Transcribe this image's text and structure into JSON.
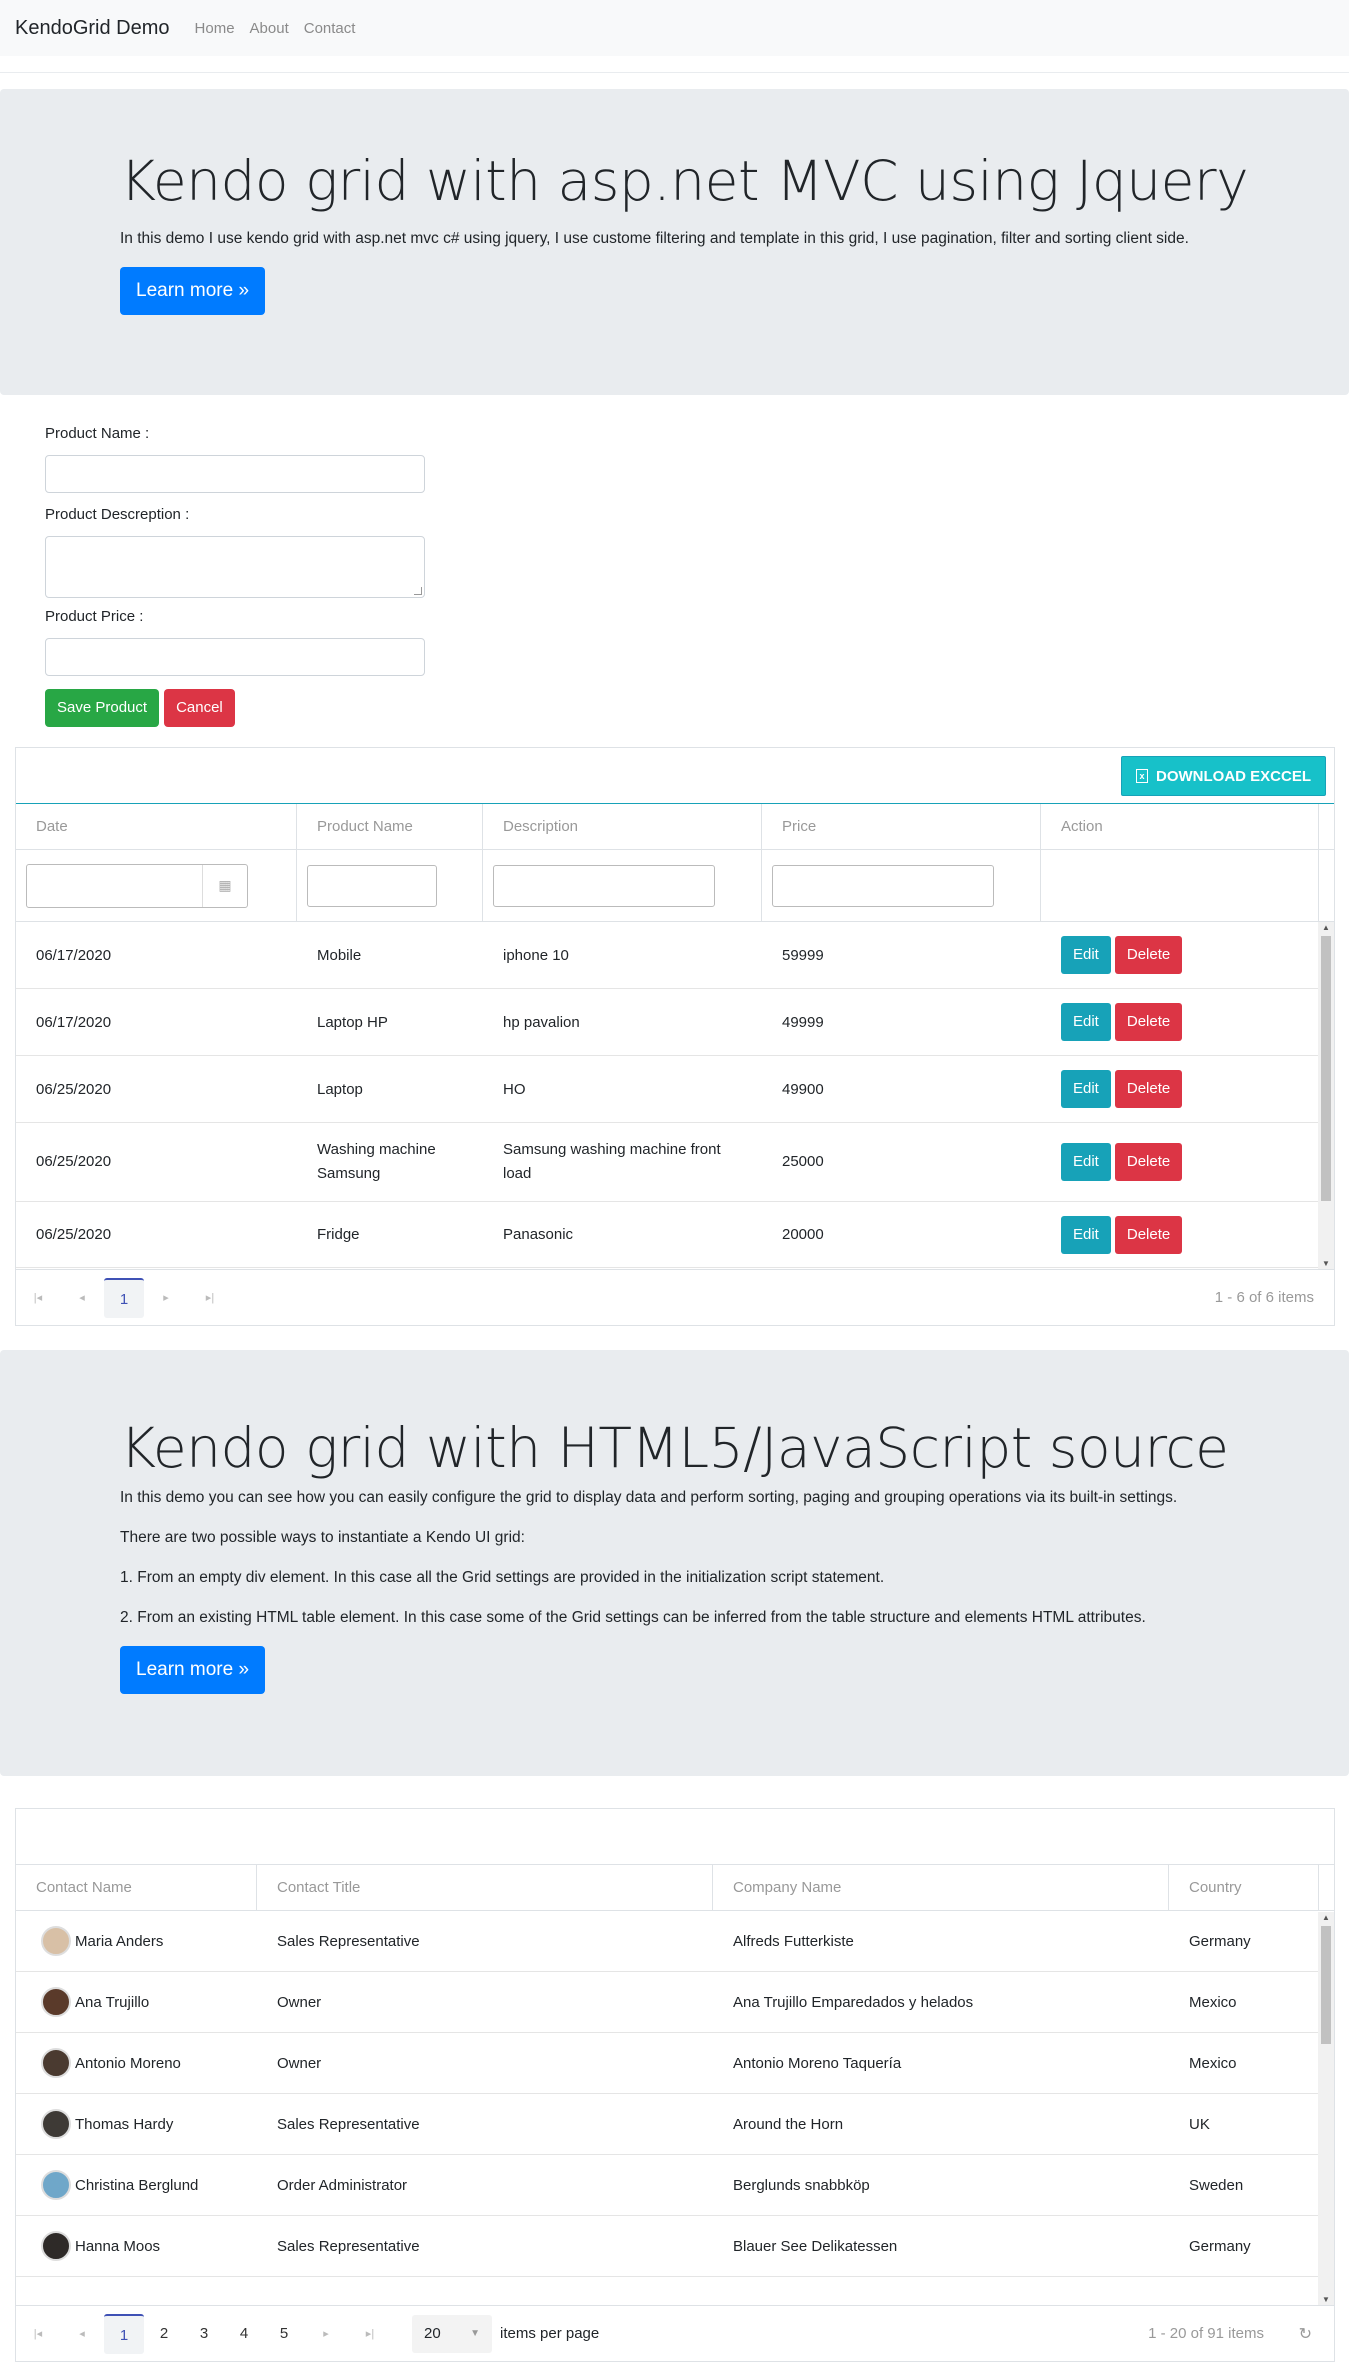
{
  "navbar": {
    "brand": "KendoGrid Demo",
    "links": [
      "Home",
      "About",
      "Contact"
    ]
  },
  "jumbo1": {
    "title": "Kendo grid with asp.net MVC using Jquery",
    "text": "In this demo I use kendo grid with asp.net mvc c# using jquery, I use custome filtering and template in this grid, I use pagination, filter and sorting client side.",
    "button": "Learn more »"
  },
  "form": {
    "name_label": "Product Name :",
    "desc_label": "Product Descreption :",
    "price_label": "Product Price :",
    "save": "Save Product",
    "cancel": "Cancel"
  },
  "grid1": {
    "excel_button": "DOWNLOAD EXCCEL",
    "columns": [
      "Date",
      "Product Name",
      "Description",
      "Price",
      "Action"
    ],
    "rows": [
      {
        "date": "06/17/2020",
        "name": "Mobile",
        "desc": "iphone 10",
        "price": "59999"
      },
      {
        "date": "06/17/2020",
        "name": "Laptop HP",
        "desc": "hp pavalion",
        "price": "49999"
      },
      {
        "date": "06/25/2020",
        "name": "Laptop",
        "desc": "HO",
        "price": "49900"
      },
      {
        "date": "06/25/2020",
        "name": "Washing machine Samsung",
        "desc": "Samsung washing machine front load",
        "price": "25000"
      },
      {
        "date": "06/25/2020",
        "name": "Fridge",
        "desc": "Panasonic",
        "price": "20000"
      }
    ],
    "edit": "Edit",
    "delete": "Delete",
    "current_page": "1",
    "pager_info": "1 - 6 of 6 items"
  },
  "jumbo2": {
    "title": "Kendo grid with HTML5/JavaScript source",
    "p1": "In this demo you can see how you can easily configure the grid to display data and perform sorting, paging and grouping operations via its built-in settings.",
    "p2": "There are two possible ways to instantiate a Kendo UI grid:",
    "p3": "1. From an empty div element. In this case all the Grid settings are provided in the initialization script statement.",
    "p4": "2. From an existing HTML table element. In this case some of the Grid settings can be inferred from the table structure and elements HTML attributes.",
    "button": "Learn more »"
  },
  "grid2": {
    "columns": [
      "Contact Name",
      "Contact Title",
      "Company Name",
      "Country"
    ],
    "rows": [
      {
        "name": "Maria Anders",
        "title": "Sales Representative",
        "company": "Alfreds Futterkiste",
        "country": "Germany"
      },
      {
        "name": "Ana Trujillo",
        "title": "Owner",
        "company": "Ana Trujillo Emparedados y helados",
        "country": "Mexico"
      },
      {
        "name": "Antonio Moreno",
        "title": "Owner",
        "company": "Antonio Moreno Taquería",
        "country": "Mexico"
      },
      {
        "name": "Thomas Hardy",
        "title": "Sales Representative",
        "company": "Around the Horn",
        "country": "UK"
      },
      {
        "name": "Christina Berglund",
        "title": "Order Administrator",
        "company": "Berglunds snabbköp",
        "country": "Sweden"
      },
      {
        "name": "Hanna Moos",
        "title": "Sales Representative",
        "company": "Blauer See Delikatessen",
        "country": "Germany"
      }
    ],
    "pages": [
      "1",
      "2",
      "3",
      "4",
      "5"
    ],
    "per_page_value": "20",
    "per_page_label": "items per page",
    "pager_info": "1 - 20 of 91 items"
  }
}
